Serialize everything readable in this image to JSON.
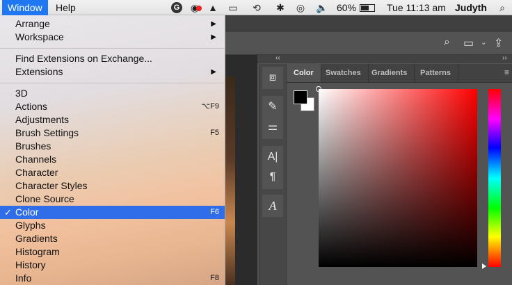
{
  "menubar": {
    "window": "Window",
    "help": "Help",
    "battery": "60%",
    "clock": "Tue 11:13 am",
    "user": "Judyth"
  },
  "menu": {
    "arrange": "Arrange",
    "workspace": "Workspace",
    "find_extensions": "Find Extensions on Exchange...",
    "extensions": "Extensions",
    "items": [
      {
        "label": "3D",
        "shortcut": ""
      },
      {
        "label": "Actions",
        "shortcut": "⌥F9"
      },
      {
        "label": "Adjustments",
        "shortcut": ""
      },
      {
        "label": "Brush Settings",
        "shortcut": "F5"
      },
      {
        "label": "Brushes",
        "shortcut": ""
      },
      {
        "label": "Channels",
        "shortcut": ""
      },
      {
        "label": "Character",
        "shortcut": ""
      },
      {
        "label": "Character Styles",
        "shortcut": ""
      },
      {
        "label": "Clone Source",
        "shortcut": ""
      },
      {
        "label": "Color",
        "shortcut": "F6",
        "checked": true
      },
      {
        "label": "Glyphs",
        "shortcut": ""
      },
      {
        "label": "Gradients",
        "shortcut": ""
      },
      {
        "label": "Histogram",
        "shortcut": ""
      },
      {
        "label": "History",
        "shortcut": ""
      },
      {
        "label": "Info",
        "shortcut": "F8"
      }
    ],
    "checkmark": "✓"
  },
  "panel": {
    "tabs": [
      "Color",
      "Swatches",
      "Gradients",
      "Patterns"
    ],
    "active_tab": "Color",
    "foreground_color": "#000000",
    "background_color": "#ffffff",
    "hue_color": "#ff0000"
  },
  "icons": {
    "grammarly": "G",
    "screen_share": "◉",
    "drive": "▲",
    "airplay": "▭",
    "time_machine": "⟲",
    "bluetooth": "✱",
    "wifi_alt": "◎",
    "volume": "🔈",
    "battery": "▭",
    "spotlight": "⌕",
    "control_center": "☰"
  }
}
